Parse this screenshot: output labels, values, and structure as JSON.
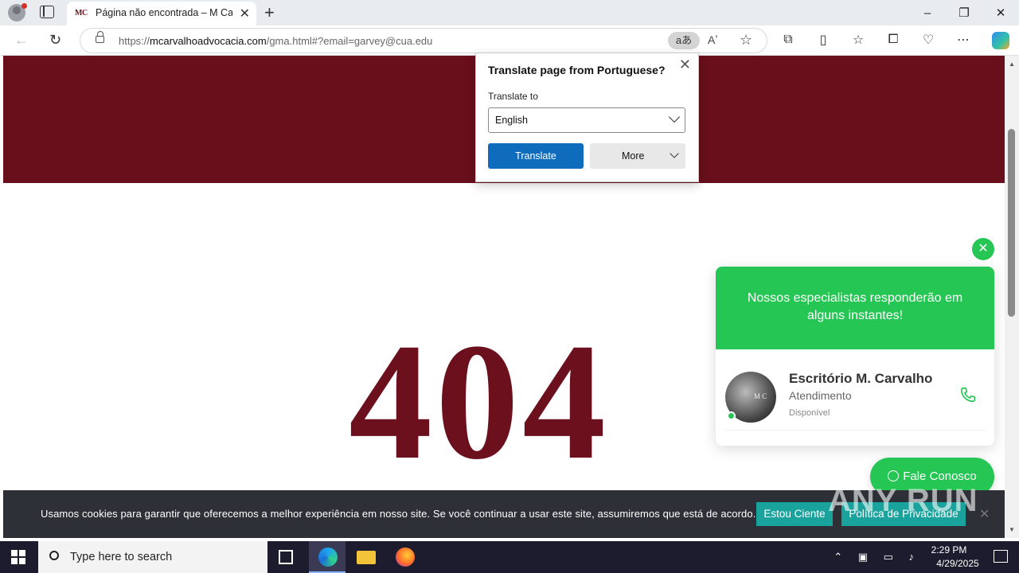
{
  "browser": {
    "tab_title": "Página não encontrada – M Carvalho Advocacia",
    "tab_favicon": "MC",
    "url_prefix": "https://",
    "url_domain": "mcarvalhoadvocacia.com",
    "url_path": "/gma.html#?email=garvey@cua.edu",
    "translate_pill": "aあ",
    "window_controls": [
      "–",
      "❐",
      "✕"
    ]
  },
  "translate_popup": {
    "title": "Translate page from Portuguese?",
    "label": "Translate to",
    "selected_language": "English",
    "translate_button": "Translate",
    "more_button": "More"
  },
  "page": {
    "error_code": "404",
    "banner_color": "#680f1b"
  },
  "whatsapp": {
    "header": "Nossos especialistas responderão em alguns instantes!",
    "agent_name": "Escritório M. Carvalho",
    "agent_role": "Atendimento",
    "agent_status": "Disponível",
    "avatar_monogram": "M C",
    "cta_button": "Fale Conosco",
    "accent": "#25c653"
  },
  "cookie_bar": {
    "message": "Usamos cookies para garantir que oferecemos a melhor experiência em nosso site. Se você continuar a usar este site, assumiremos que está de acordo.",
    "accept_button": "Estou Ciente",
    "policy_button": "Política de Privacidade",
    "accent": "#1aa39d"
  },
  "watermark": "ANY RUN",
  "taskbar": {
    "search_placeholder": "Type here to search",
    "time": "2:29 PM",
    "date": "4/29/2025"
  }
}
